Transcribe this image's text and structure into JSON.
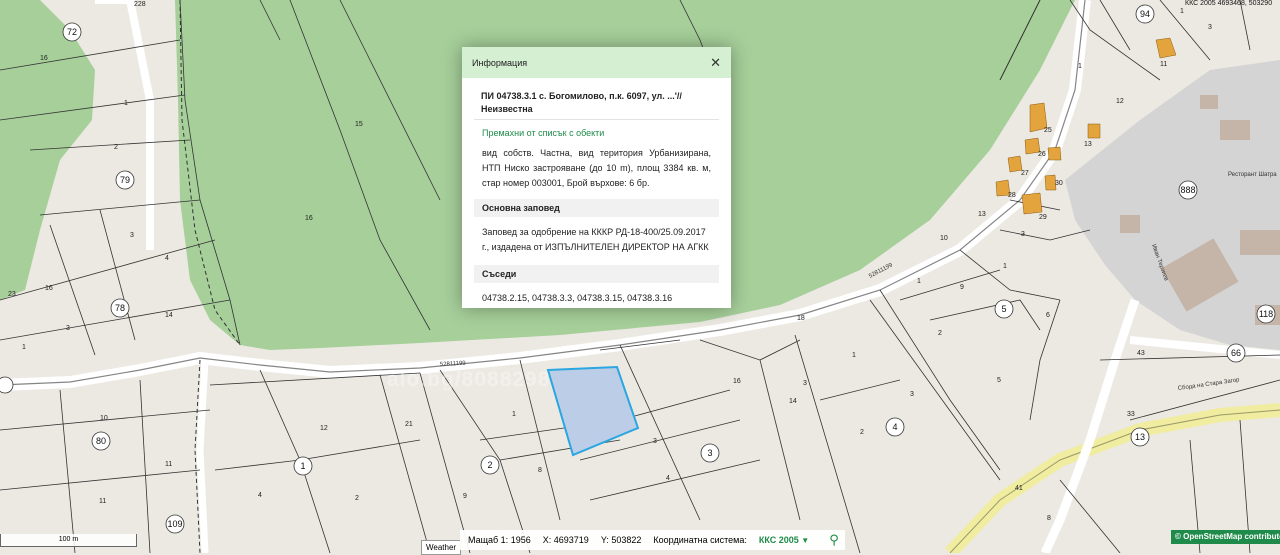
{
  "map": {
    "coord_top": "ККС 2005 4693468, 503290",
    "watermark": "alo.bg/8088298",
    "road_labels": [
      "52811199",
      "52811199",
      "Сбода на Стара Загор"
    ],
    "street_label": "Иван Терзиев",
    "circled_labels": [
      "72",
      "79",
      "78",
      "80",
      "109",
      "1",
      "2",
      "3",
      "5",
      "4",
      "13",
      "66",
      "94",
      "118",
      "888"
    ],
    "parcel_labels": [
      "228",
      "16",
      "1",
      "15",
      "16",
      "2",
      "3",
      "4",
      "16",
      "23",
      "1",
      "14",
      "3",
      "12",
      "10",
      "4",
      "21",
      "1",
      "8",
      "9",
      "2",
      "11",
      "11",
      "3",
      "16",
      "14",
      "4",
      "3",
      "1",
      "2",
      "18",
      "1",
      "3",
      "2",
      "5",
      "6",
      "9",
      "1",
      "10",
      "13",
      "8",
      "41",
      "33",
      "43",
      "25",
      "26",
      "27",
      "28",
      "29",
      "30",
      "13",
      "11",
      "12",
      "1",
      "1",
      "3",
      "3"
    ],
    "restaurant_label": "Ресторант Шатра"
  },
  "panel": {
    "header_title": "Информация",
    "close_icon": "close-icon",
    "parcel_title": "ПИ 04738.3.1 с. Богомилово, п.к. 6097, ул. ...'// Неизвестна",
    "remove_link": "Премахни от списък с обекти",
    "description": "вид собств. Частна, вид територия Урбанизирана, НТП Ниско застрояване (до 10 m), площ 3384 кв. м, стар номер 003001, Брой върхове: 6 бр.",
    "order_heading": "Основна заповед",
    "order_text": "Заповед за одобрение на КККР РД-18-400/25.09.2017 г., издадена от ИЗПЪЛНИТЕЛЕН ДИРЕКТОР НА АГКК",
    "neighbours_heading": "Съседи",
    "neighbours_text": "04738.2.15, 04738.3.3, 04738.3.15, 04738.3.16"
  },
  "status": {
    "scale_label": "100 m",
    "weather_label": "Weather",
    "scale_text": "Мащаб 1:",
    "scale_value": "1956",
    "x_label": "X:",
    "x_value": "4693719",
    "y_label": "Y:",
    "y_value": "503822",
    "crs_label": "Координатна система:",
    "crs_value": "ККС 2005",
    "dropdown_icon": "chevron-down-icon",
    "search_icon": "search-icon",
    "attribution": "© OpenStreetMap contributors"
  },
  "colors": {
    "forest": "#a6cf9a",
    "land": "#ece9e2",
    "urban": "#d4d4d4",
    "selected_parcel": "#bccde8",
    "selected_border": "#2aa6e0",
    "building": "#e3a43d",
    "accent": "#1e8b4a",
    "highway": "#f0eca0"
  }
}
